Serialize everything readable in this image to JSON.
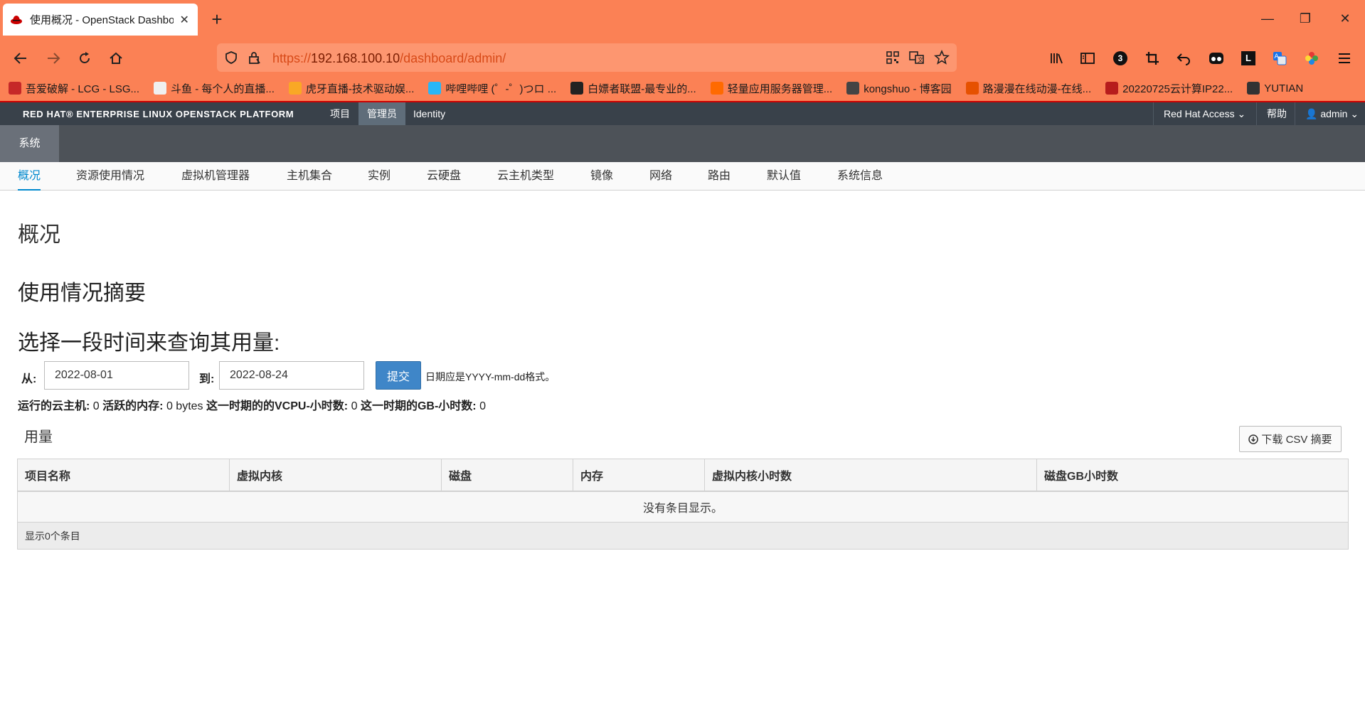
{
  "browser": {
    "tab_title": "使用概况 - OpenStack Dashboard",
    "url_prefix": "https://",
    "url_host": "192.168.100.10",
    "url_path": "/dashboard/admin/",
    "extension_badge": "3",
    "bookmarks": [
      {
        "label": "吾爱破解 - LCG - LSG...",
        "color": "#c62828"
      },
      {
        "label": "斗鱼 - 每个人的直播...",
        "color": "#f0f0f0"
      },
      {
        "label": "虎牙直播-技术驱动娱...",
        "color": "#f9a825"
      },
      {
        "label": "哔哩哔哩 (゜-゜)つロ ...",
        "color": "#29b6f6"
      },
      {
        "label": "白嫖者联盟-最专业的...",
        "color": "#222222"
      },
      {
        "label": "轻量应用服务器管理...",
        "color": "#ff6a00"
      },
      {
        "label": "kongshuo - 博客园",
        "color": "#444444"
      },
      {
        "label": "路漫漫在线动漫-在线...",
        "color": "#e65100"
      },
      {
        "label": "20220725云计算IP22...",
        "color": "#b71c1c"
      },
      {
        "label": "YUTIAN",
        "color": "#333333"
      }
    ]
  },
  "dashboard": {
    "brand": "RED HAT® ENTERPRISE LINUX OPENSTACK PLATFORM",
    "top_menu": [
      "项目",
      "管理员",
      "Identity"
    ],
    "right_menu": {
      "access": "Red Hat Access",
      "help": "帮助",
      "user": "admin"
    },
    "sub_tab": "系统",
    "panel_nav": [
      "概况",
      "资源使用情况",
      "虚拟机管理器",
      "主机集合",
      "实例",
      "云硬盘",
      "云主机类型",
      "镜像",
      "网络",
      "路由",
      "默认值",
      "系统信息"
    ]
  },
  "page": {
    "title": "概况",
    "summary_heading": "使用情况摘要",
    "select_heading": "选择一段时间来查询其用量:",
    "from_label": "从:",
    "from_value": "2022-08-01",
    "to_label": "到:",
    "to_value": "2022-08-24",
    "submit_label": "提交",
    "date_help": "日期应是YYYY-mm-dd格式。",
    "stats": {
      "active_instances_label": "运行的云主机:",
      "active_instances": "0",
      "active_ram_label": "活跃的内存:",
      "active_ram": "0 bytes",
      "vcpu_hours_label": "这一时期的的VCPU-小时数:",
      "vcpu_hours": "0",
      "gb_hours_label": "这一时期的GB-小时数:",
      "gb_hours": "0"
    },
    "usage_title": "用量",
    "csv_label": "下载 CSV 摘要",
    "table": {
      "headers": [
        "项目名称",
        "虚拟内核",
        "磁盘",
        "内存",
        "虚拟内核小时数",
        "磁盘GB小时数"
      ],
      "empty_message": "没有条目显示。",
      "footer": "显示0个条目"
    }
  },
  "colors": {
    "chrome": "#fb8155",
    "topbar": "#39414a",
    "accent": "#0088ce",
    "button": "#3f86c8"
  }
}
